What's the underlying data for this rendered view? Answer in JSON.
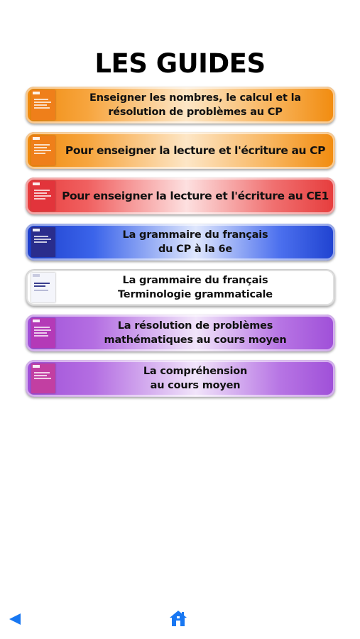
{
  "header": {
    "title": "LES GUIDES"
  },
  "guides": [
    {
      "lines": [
        "Enseigner les nombres, le calcul et la",
        "résolution de problèmes au CP"
      ],
      "theme": "orange",
      "cover_color": "#ef7f1a"
    },
    {
      "lines": [
        "Pour enseigner la lecture et l'écriture au CP"
      ],
      "theme": "orange",
      "cover_color": "#ef7f1a"
    },
    {
      "lines": [
        "Pour enseigner la lecture et l'écriture au CE1"
      ],
      "theme": "red",
      "cover_color": "#e2343b"
    },
    {
      "lines": [
        "La grammaire du français",
        "du CP à la 6e"
      ],
      "theme": "blue",
      "cover_color": "#2a2d8c"
    },
    {
      "lines": [
        "La grammaire du français",
        "Terminologie grammaticale"
      ],
      "theme": "white",
      "cover_color": "#f4f5fb"
    },
    {
      "lines": [
        "La résolution de problèmes",
        "mathématiques au cours moyen"
      ],
      "theme": "purple",
      "cover_color": "#b43ab7"
    },
    {
      "lines": [
        "La compréhension",
        "au cours moyen"
      ],
      "theme": "purple",
      "cover_color": "#c23fa2"
    }
  ],
  "nav": {
    "back_icon": "back-arrow-icon",
    "home_icon": "home-icon",
    "accent_color": "#1877f2"
  }
}
